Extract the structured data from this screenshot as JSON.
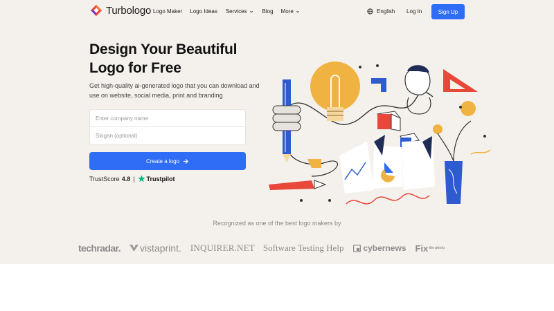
{
  "header": {
    "brand_name": "Turbologo",
    "nav": [
      {
        "label": "Logo Maker",
        "dropdown": false
      },
      {
        "label": "Logo Ideas",
        "dropdown": false
      },
      {
        "label": "Services",
        "dropdown": true
      },
      {
        "label": "Blog",
        "dropdown": false
      },
      {
        "label": "More",
        "dropdown": true
      }
    ],
    "language": "English",
    "login_label": "Log In",
    "signup_label": "Sign Up"
  },
  "hero": {
    "title_line1": "Design Your Beautiful",
    "title_line2": "Logo for Free",
    "subtitle": "Get high-quality ai-generated logo that you can download and use on website, social media, print and branding",
    "company_placeholder": "Enter company name",
    "slogan_placeholder": "Slogan (optional)",
    "cta_label": "Create a logo",
    "trust_label": "TrustScore",
    "trust_score": "4.8",
    "trust_sep": "|",
    "trustpilot": "Trustpilot"
  },
  "recognized": {
    "title": "Recognized as one of the best logo makers by",
    "brands": [
      "techradar.",
      "vistaprint.",
      "INQUIRER.NET",
      "Software Testing Help",
      "cybernews",
      "Fix",
      "the photo"
    ]
  },
  "icons": {
    "brand": "turbologo-logo-icon",
    "chevron": "chevron-down-icon",
    "globe": "globe-icon",
    "arrow": "arrow-right-icon",
    "star": "trustpilot-star-icon"
  },
  "colors": {
    "accent": "#2f6df6",
    "hero_background": "#f4f1ec",
    "trustpilot_green": "#00b67a",
    "brand_red": "#e8473a",
    "brand_purple": "#7a3cc8"
  }
}
